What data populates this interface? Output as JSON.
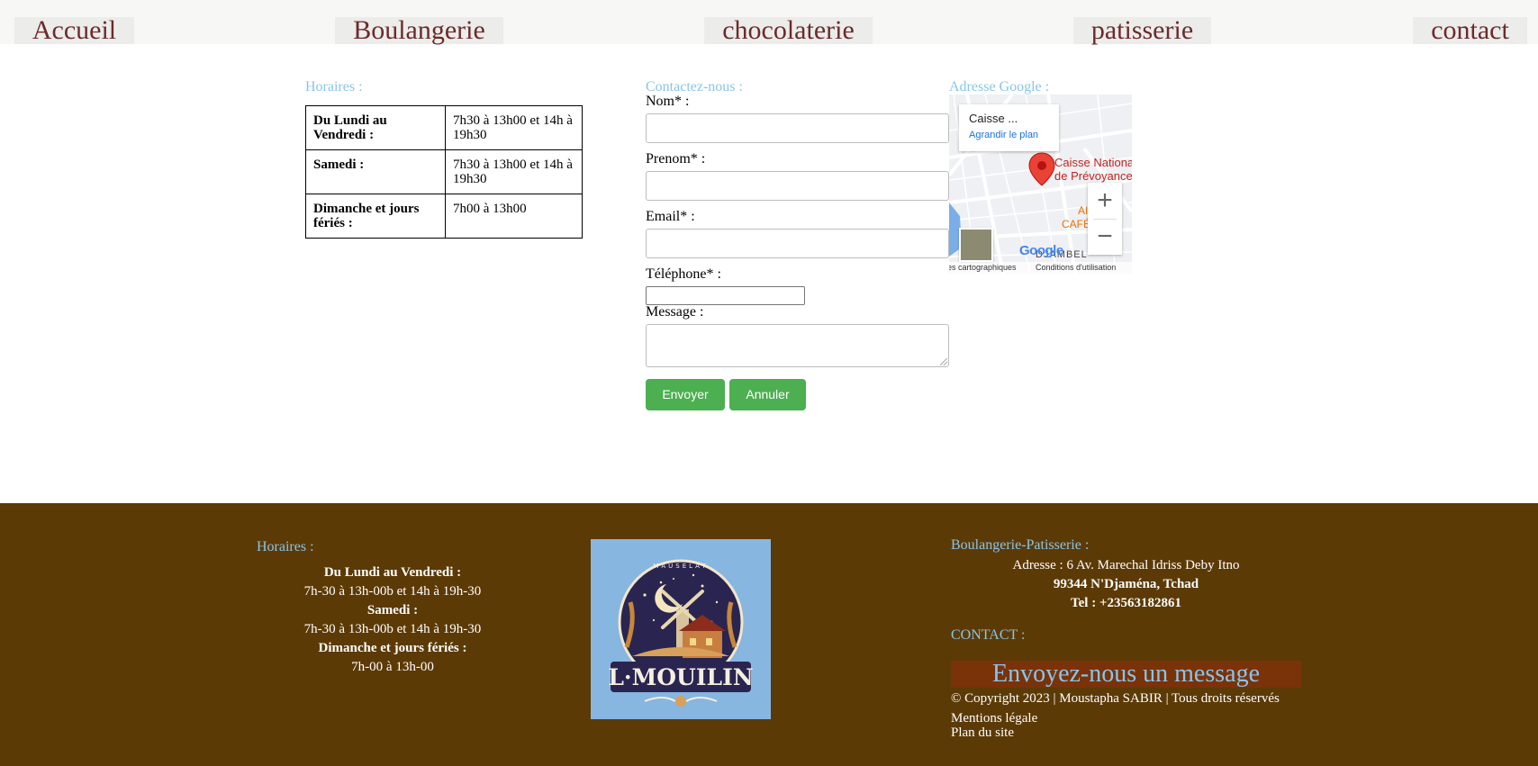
{
  "nav": {
    "items": [
      "Accueil",
      "Boulangerie",
      "chocolaterie",
      "patisserie",
      "contact"
    ]
  },
  "hours": {
    "title": "Horaires :",
    "rows": [
      {
        "day": "Du Lundi au Vendredi :",
        "time": "7h30 à 13h00 et 14h à 19h30"
      },
      {
        "day": "Samedi :",
        "time": "7h30 à 13h00 et 14h à 19h30"
      },
      {
        "day": "Dimanche et jours fériés :",
        "time": "7h00 à 13h00"
      }
    ]
  },
  "contact_form": {
    "title": "Contactez-nous :",
    "nom_label": "Nom* :",
    "prenom_label": "Prenom* :",
    "email_label": "Email* :",
    "telephone_label": "Téléphone* :",
    "message_label": "Message :",
    "nom_value": "",
    "prenom_value": "",
    "email_value": "",
    "telephone_value": "",
    "message_value": "",
    "submit_label": "Envoyer",
    "cancel_label": "Annuler"
  },
  "map": {
    "title": "Adresse Google :",
    "card_title": "Caisse ...",
    "card_link": "Agrandir le plan",
    "place_label_1": "Caisse Nationale",
    "place_label_2": "de Prévoyance",
    "poi_label_1": "AI",
    "poi_label_2": "CAFÉ",
    "zoom_in": "+",
    "zoom_out": "−",
    "district": "DJAMBEL",
    "google_logo": "Google",
    "footer_left": "es cartographiques",
    "footer_right": "Conditions d'utilisation",
    "colors": {
      "marker": "#ea4335",
      "place": "#c5221f",
      "link": "#1a73e8"
    }
  },
  "footer": {
    "hours_title": "Horaires :",
    "hours_lines": [
      "Du Lundi au Vendredi :",
      "7h-30 à 13h-00b et 14h à 19h-30",
      "Samedi :",
      "7h-30 à 13h-00b et 14h à 19h-30",
      "Dimanche et jours fériés :",
      "7h-00 à 13h-00"
    ],
    "logo_text": "L·MOUILIN",
    "logo_arc_text": "MAUSELAT",
    "business_title": "Boulangerie-Patisserie :",
    "address_line1": "Adresse : 6 Av. Marechal Idriss Deby Itno",
    "address_line2": "99344 N'Djaména, Tchad",
    "phone": "Tel : +23563182861",
    "contact_title": "CONTACT :",
    "message_button": "Envoyez-nous un message",
    "copyright": "© Copyright 2023 | Moustapha SABIR | Tous droits réservés",
    "mentions": "Mentions légale",
    "sitemap": "Plan du site"
  },
  "colors": {
    "nav_text": "#6b2b2b",
    "section_title": "#87c5ec",
    "button_green": "#4caf50",
    "footer_bg": "#5c3a06",
    "message_button_bg": "#7a3208",
    "logo_bg": "#87b6e0"
  }
}
